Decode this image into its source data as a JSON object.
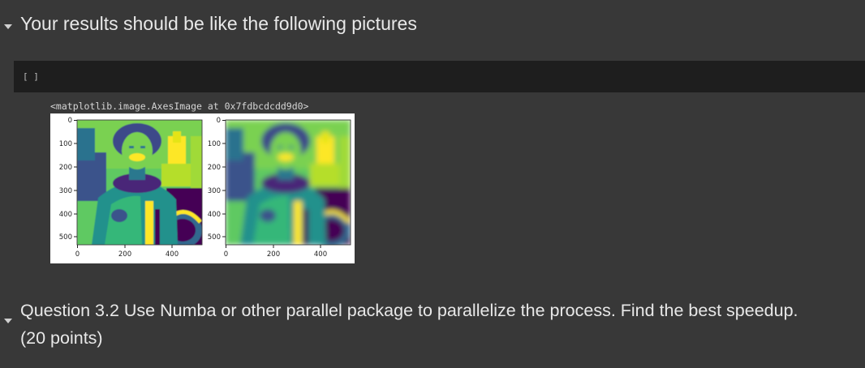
{
  "section1": {
    "heading": "Your results should be like the following pictures",
    "caret_icon": "chevron-down-icon"
  },
  "cell": {
    "run_indicator": "[ ]",
    "output_repr": "<matplotlib.image.AxesImage at 0x7fdbcdcdd9d0>"
  },
  "figure": {
    "panels": [
      {
        "name": "original",
        "y_ticks": [
          "0",
          "100",
          "200",
          "300",
          "400",
          "500"
        ],
        "x_ticks": [
          "0",
          "200",
          "400"
        ]
      },
      {
        "name": "blurred",
        "y_ticks": [
          "0",
          "100",
          "200",
          "300",
          "400",
          "500"
        ],
        "x_ticks": [
          "0",
          "200",
          "400"
        ]
      }
    ],
    "colormap": [
      "#440154",
      "#3b528b",
      "#21918c",
      "#5ec962",
      "#fde725"
    ]
  },
  "section2": {
    "heading_line1": "Question 3.2 Use Numba or other parallel package to parallelize the process. Find the best speedup.",
    "heading_line2": "(20 points)",
    "caret_icon": "chevron-down-icon"
  }
}
